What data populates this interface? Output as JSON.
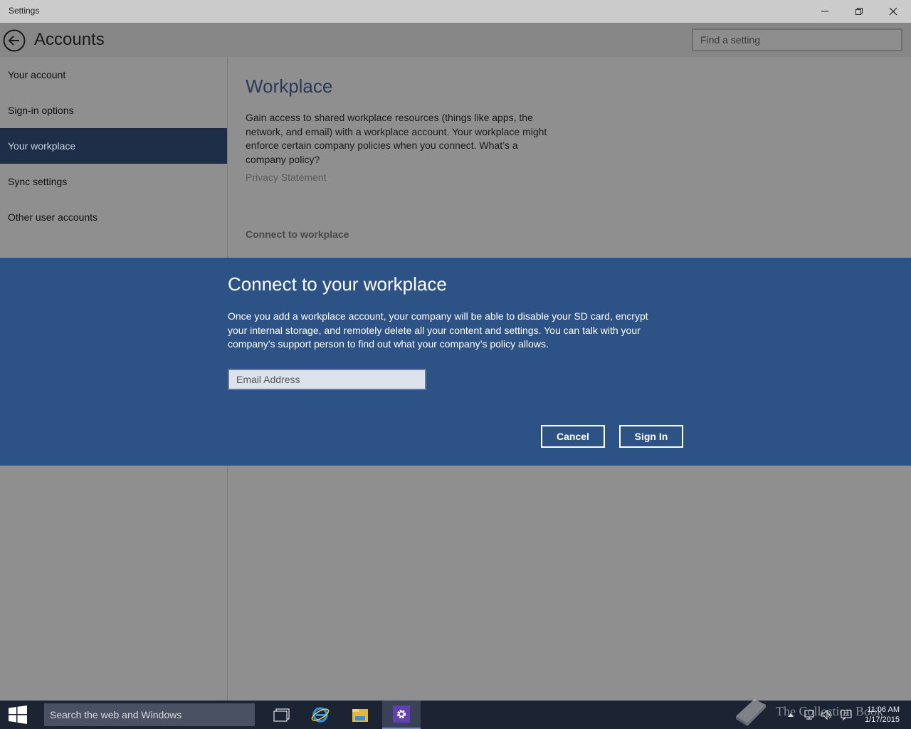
{
  "window": {
    "title": "Settings"
  },
  "header": {
    "title": "Accounts",
    "search_placeholder": "Find a setting"
  },
  "sidebar": {
    "items": [
      {
        "label": "Your account"
      },
      {
        "label": "Sign-in options"
      },
      {
        "label": "Your workplace"
      },
      {
        "label": "Sync settings"
      },
      {
        "label": "Other user accounts"
      }
    ],
    "active_index": 2
  },
  "main": {
    "heading": "Workplace",
    "description": "Gain access to shared workplace resources (things like apps, the network, and email) with a workplace account. Your workplace might enforce certain company policies when you connect. What’s a company policy?",
    "privacy_link": "Privacy Statement",
    "connect_link": "Connect to workplace"
  },
  "dialog": {
    "title": "Connect to your workplace",
    "body": "Once you add a workplace account, your company will be able to disable your SD card, encrypt your internal storage, and remotely delete all your content and settings.  You can talk with your company’s support person to find out what your company’s policy allows.",
    "email_placeholder": "Email Address",
    "email_value": "",
    "cancel_label": "Cancel",
    "signin_label": "Sign In"
  },
  "taskbar": {
    "search_placeholder": "Search the web and Windows",
    "apps": [
      "task-view-icon",
      "internet-explorer-icon",
      "file-explorer-icon",
      "settings-icon"
    ],
    "active_app": "settings-icon",
    "time": "11:06 AM",
    "date": "1/17/2015",
    "watermark": "The Collection Book"
  },
  "colors": {
    "dialog_bg": "#2d5286",
    "sidebar_active_bg": "#1f2e48",
    "taskbar_bg": "#1c2333",
    "dimmed_bg": "#8f8f8f"
  }
}
